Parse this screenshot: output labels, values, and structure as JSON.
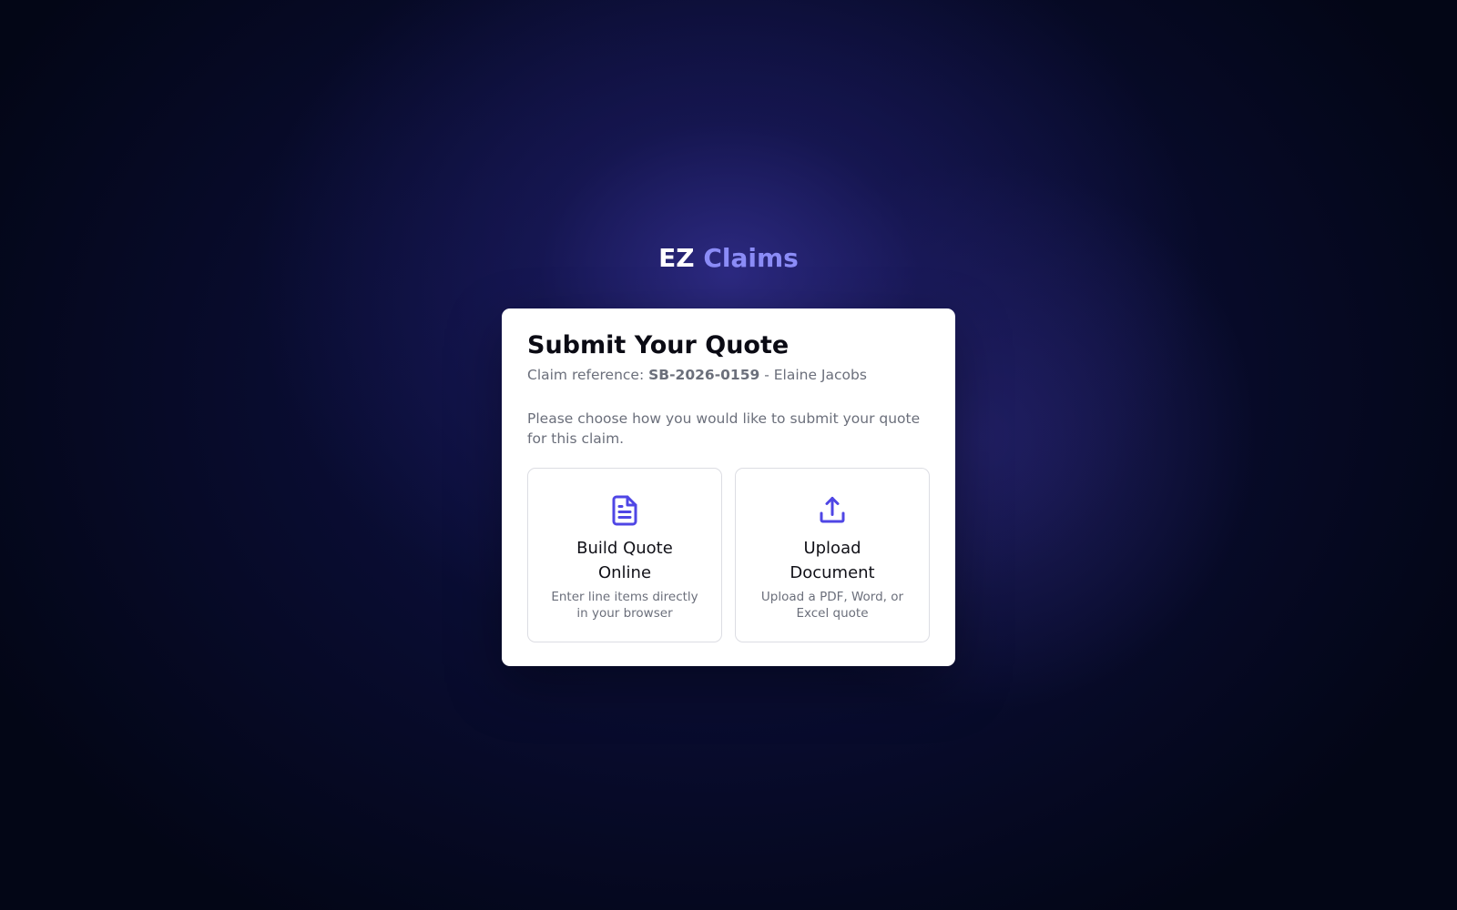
{
  "brand": {
    "prefix": "EZ",
    "accent": "Claims",
    "accent_color": "#8b8cf7"
  },
  "card": {
    "title": "Submit Your Quote",
    "claim_reference_label": "Claim reference:",
    "claim_reference": "SB-2026-0159",
    "separator": "-",
    "claimant_name": "Elaine Jacobs",
    "intro": "Please choose how you would like to submit your quote for this claim."
  },
  "options": [
    {
      "title": "Build Quote Online",
      "description": "Enter line items directly in your browser",
      "icon": "document-icon"
    },
    {
      "title": "Upload Document",
      "description": "Upload a PDF, Word, or Excel quote",
      "icon": "upload-icon"
    }
  ],
  "colors": {
    "icon": "#4f46e5",
    "background": "#030616"
  }
}
